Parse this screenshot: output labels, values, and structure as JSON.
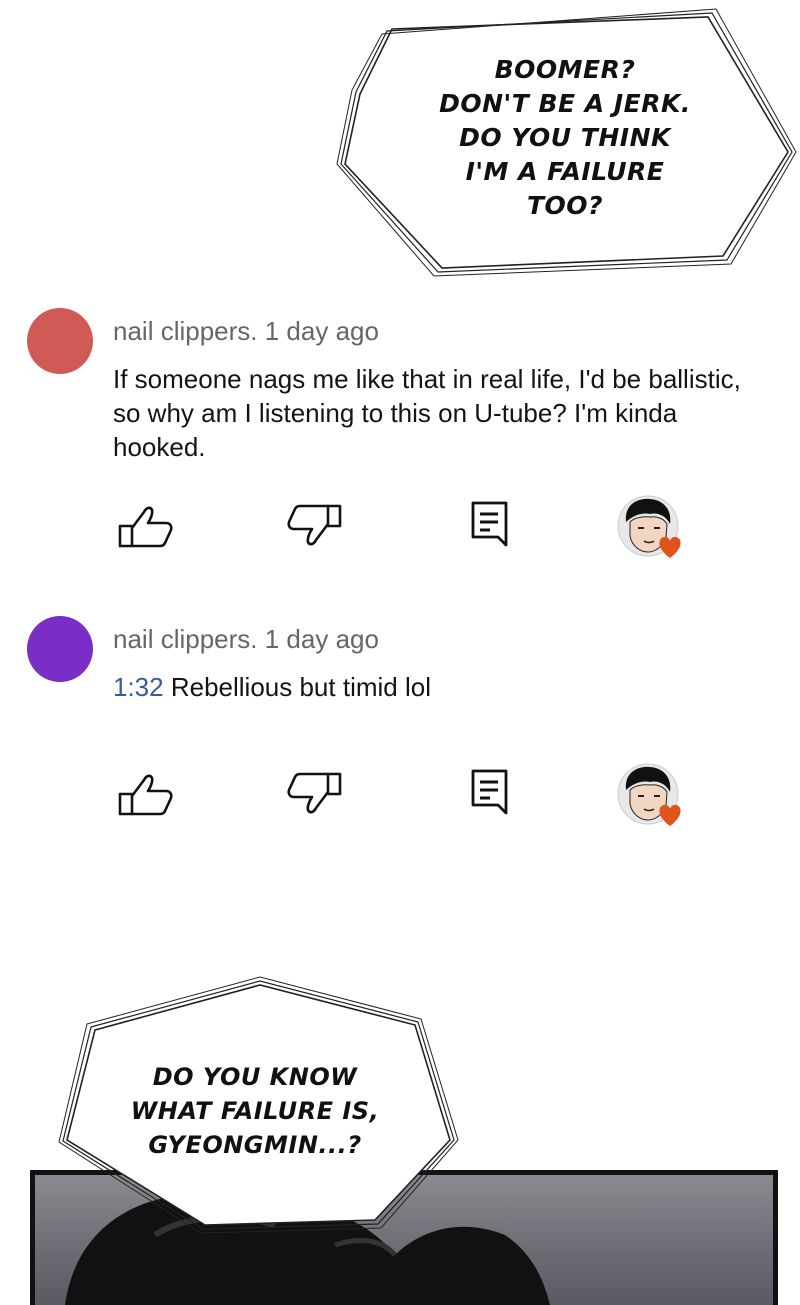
{
  "top_bubble": {
    "lines": [
      "BOOMER?",
      "DON'T BE A JERK.",
      "DO YOU THINK",
      "I'M A FAILURE",
      "TOO?"
    ]
  },
  "comments": [
    {
      "author": "nail clippers.",
      "time": "1 day ago",
      "avatar_color": "#d05a55",
      "text": "If someone nags me like that in real life, I'd be ballistic, so why am I listening to this on U-tube? I'm kinda hooked.",
      "timestamp_link": ""
    },
    {
      "author": "nail clippers.",
      "time": "1 day ago",
      "avatar_color": "#7b2ec6",
      "timestamp_link": "1:32",
      "text": "Rebellious but timid lol"
    }
  ],
  "action_icons": [
    "thumbs-up-icon",
    "thumbs-down-icon",
    "reply-icon",
    "creator-heart-avatar"
  ],
  "bottom_bubble": {
    "lines": [
      "DO YOU KNOW",
      "WHAT FAILURE IS,",
      "GYEONGMIN...?"
    ]
  },
  "colors": {
    "heart": "#e0541b",
    "link": "#3a5a9a",
    "meta": "#666666"
  }
}
